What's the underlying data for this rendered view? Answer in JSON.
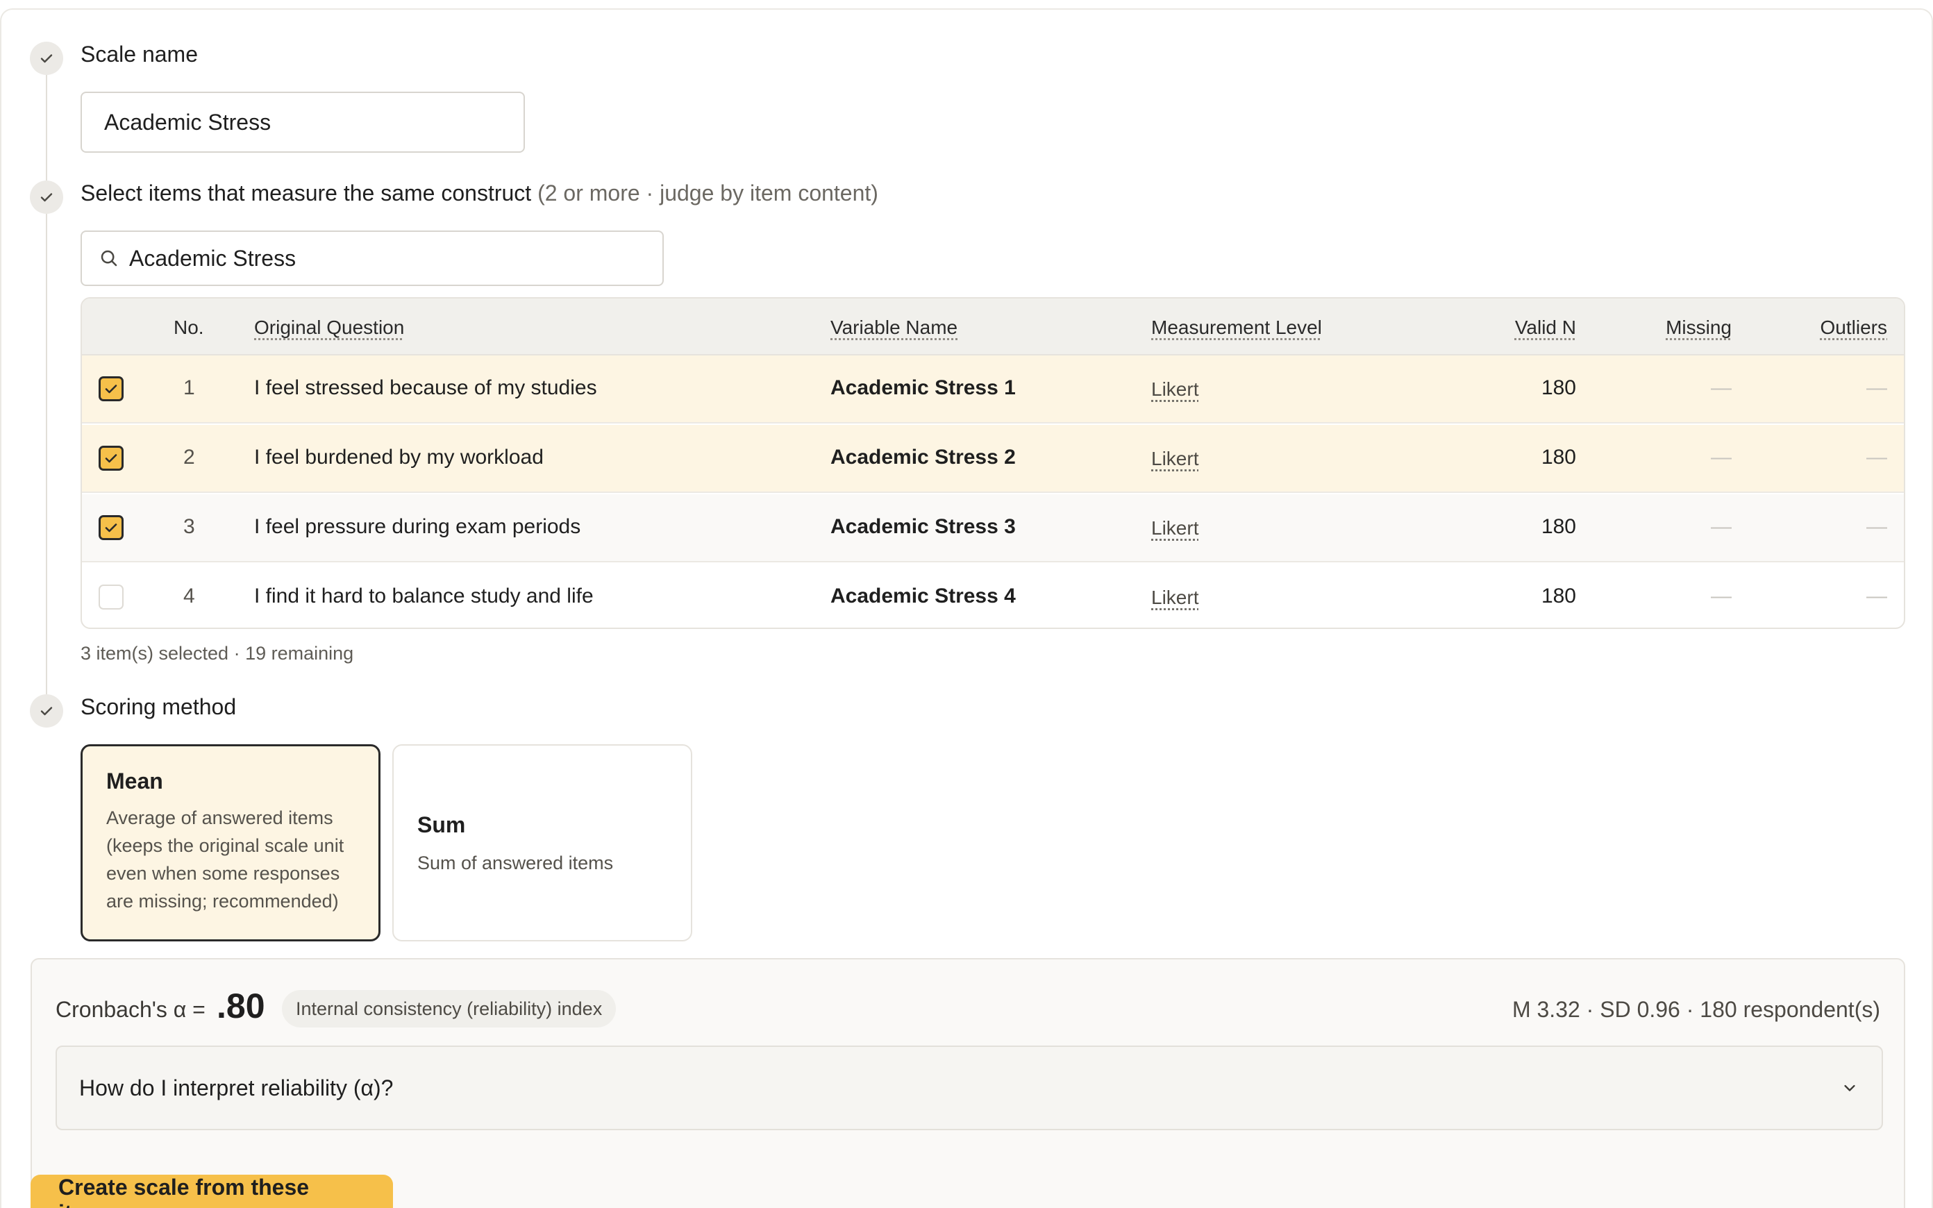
{
  "steps": {
    "scale_name": {
      "title": "Scale name",
      "value": "Academic Stress"
    },
    "select_items": {
      "title": "Select items that measure the same construct",
      "hint": "(2 or more · judge by item content)",
      "search_value": "Academic Stress"
    },
    "scoring": {
      "title": "Scoring method"
    }
  },
  "table": {
    "headers": {
      "no": "No.",
      "question": "Original Question",
      "variable": "Variable Name",
      "level": "Measurement Level",
      "valid_n": "Valid N",
      "missing": "Missing",
      "outliers": "Outliers"
    },
    "rows": [
      {
        "selected": true,
        "no": "1",
        "question": "I feel stressed because of my studies",
        "variable": "Academic Stress 1",
        "level": "Likert",
        "valid_n": "180",
        "missing": "—",
        "outliers": "—"
      },
      {
        "selected": true,
        "no": "2",
        "question": "I feel burdened by my workload",
        "variable": "Academic Stress 2",
        "level": "Likert",
        "valid_n": "180",
        "missing": "—",
        "outliers": "—"
      },
      {
        "selected": true,
        "no": "3",
        "question": "I feel pressure during exam periods",
        "variable": "Academic Stress 3",
        "level": "Likert",
        "valid_n": "180",
        "missing": "—",
        "outliers": "—"
      },
      {
        "selected": false,
        "no": "4",
        "question": "I find it hard to balance study and life",
        "variable": "Academic Stress 4",
        "level": "Likert",
        "valid_n": "180",
        "missing": "—",
        "outliers": "—"
      }
    ],
    "summary": "3 item(s) selected · 19 remaining"
  },
  "scoring_options": {
    "mean": {
      "title": "Mean",
      "description": "Average of answered items (keeps the original scale unit even when some responses are missing; recommended)",
      "selected": true
    },
    "sum": {
      "title": "Sum",
      "description": "Sum of answered items",
      "selected": false
    }
  },
  "reliability": {
    "label": "Cronbach's α =",
    "value": ".80",
    "chip": "Internal consistency (reliability) index",
    "stats": "M 3.32 · SD 0.96 · 180 respondent(s)",
    "interpret_question": "How do I interpret reliability (α)?"
  },
  "actions": {
    "create_label": "Create scale from these items"
  },
  "colors": {
    "accent": "#f6c04a",
    "selected_row_bg": "#fdf5e3",
    "border": "#e6e3dd"
  },
  "icons": {
    "step_done": "check-icon",
    "search": "search-icon",
    "expand": "chevron-down-icon"
  }
}
